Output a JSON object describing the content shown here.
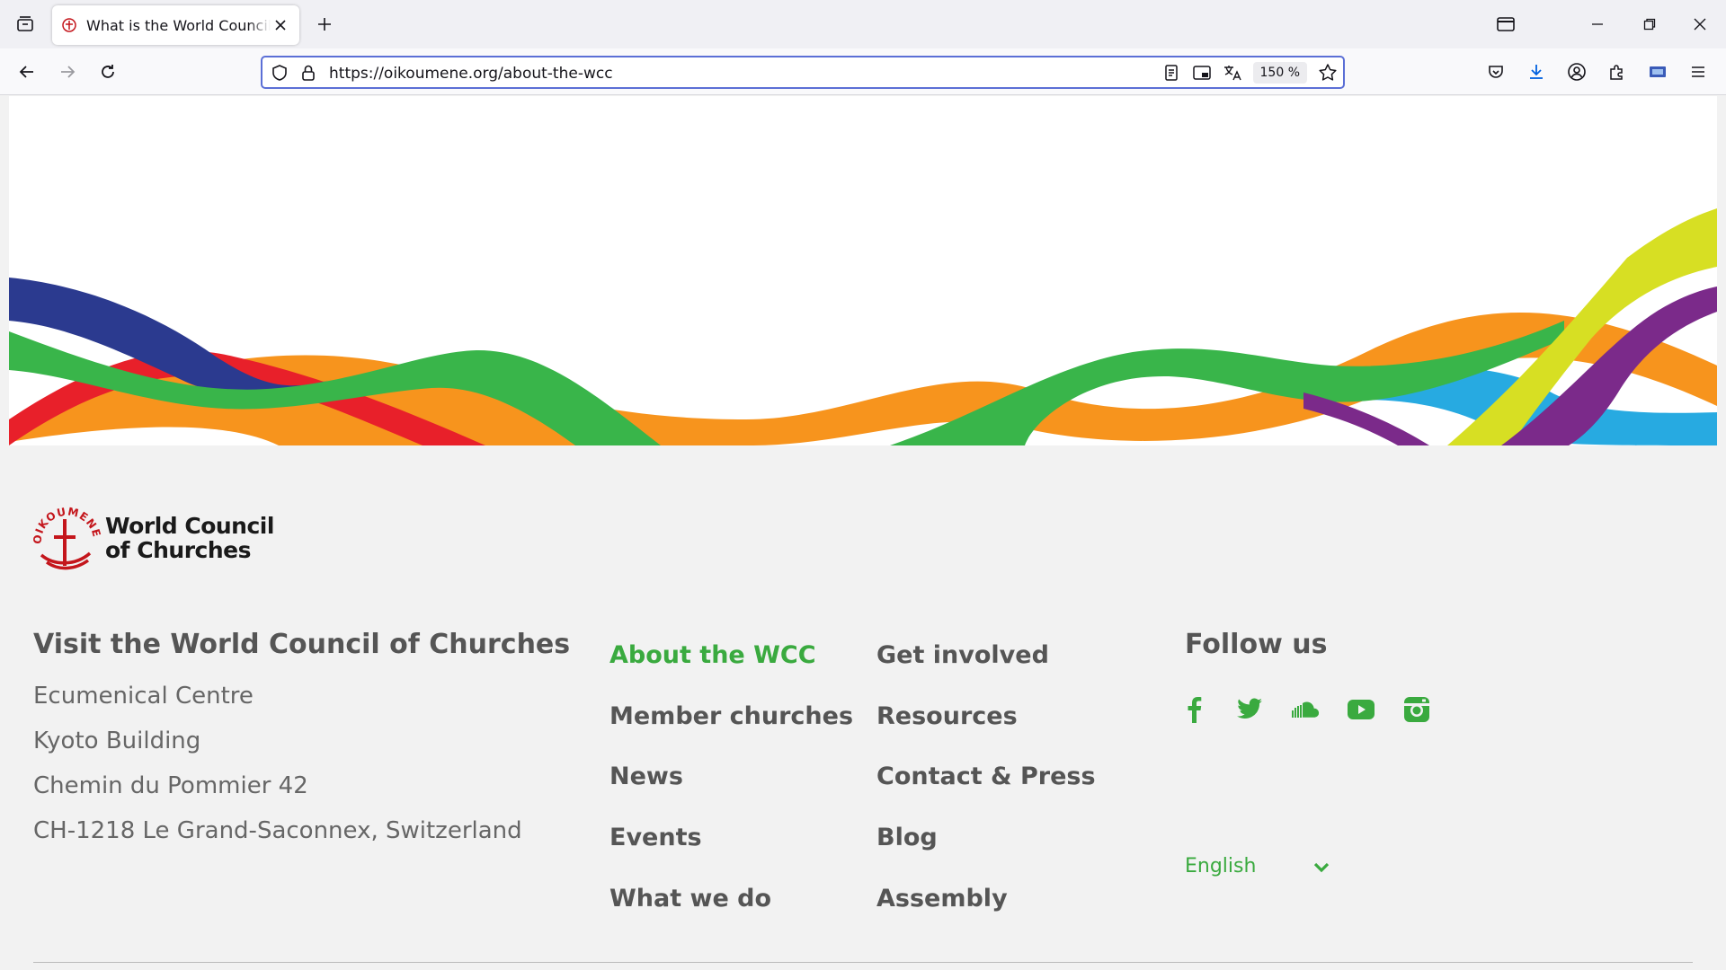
{
  "browser": {
    "tab_title": "What is the World Council of Churches",
    "url": "https://oikoumene.org/about-the-wcc",
    "zoom": "150 %"
  },
  "footer": {
    "logo_line1": "World Council",
    "logo_line2": "of Churches",
    "logo_arc": "OIKOUMENE",
    "visit_title": "Visit the World Council of Churches",
    "address": [
      "Ecumenical Centre",
      "Kyoto Building",
      "Chemin du Pommier 42",
      "CH-1218 Le Grand-Saconnex, Switzerland"
    ],
    "nav_col1": [
      "About the WCC",
      "Member churches",
      "News",
      "Events",
      "What we do"
    ],
    "nav_col2": [
      "Get involved",
      "Resources",
      "Contact & Press",
      "Blog",
      "Assembly"
    ],
    "follow_title": "Follow us",
    "social": [
      "facebook-icon",
      "twitter-icon",
      "soundcloud-icon",
      "youtube-icon",
      "instagram-icon"
    ],
    "language": "English"
  },
  "colors": {
    "accent_green": "#3aaa3f",
    "wave_blue": "#2b3a8f",
    "wave_red": "#e8202a",
    "wave_orange": "#f7941d",
    "wave_green": "#39b54a",
    "wave_purple": "#7b2a8a",
    "wave_lime": "#d7df23",
    "wave_cyan": "#27aae1",
    "logo_red": "#c4161c"
  }
}
